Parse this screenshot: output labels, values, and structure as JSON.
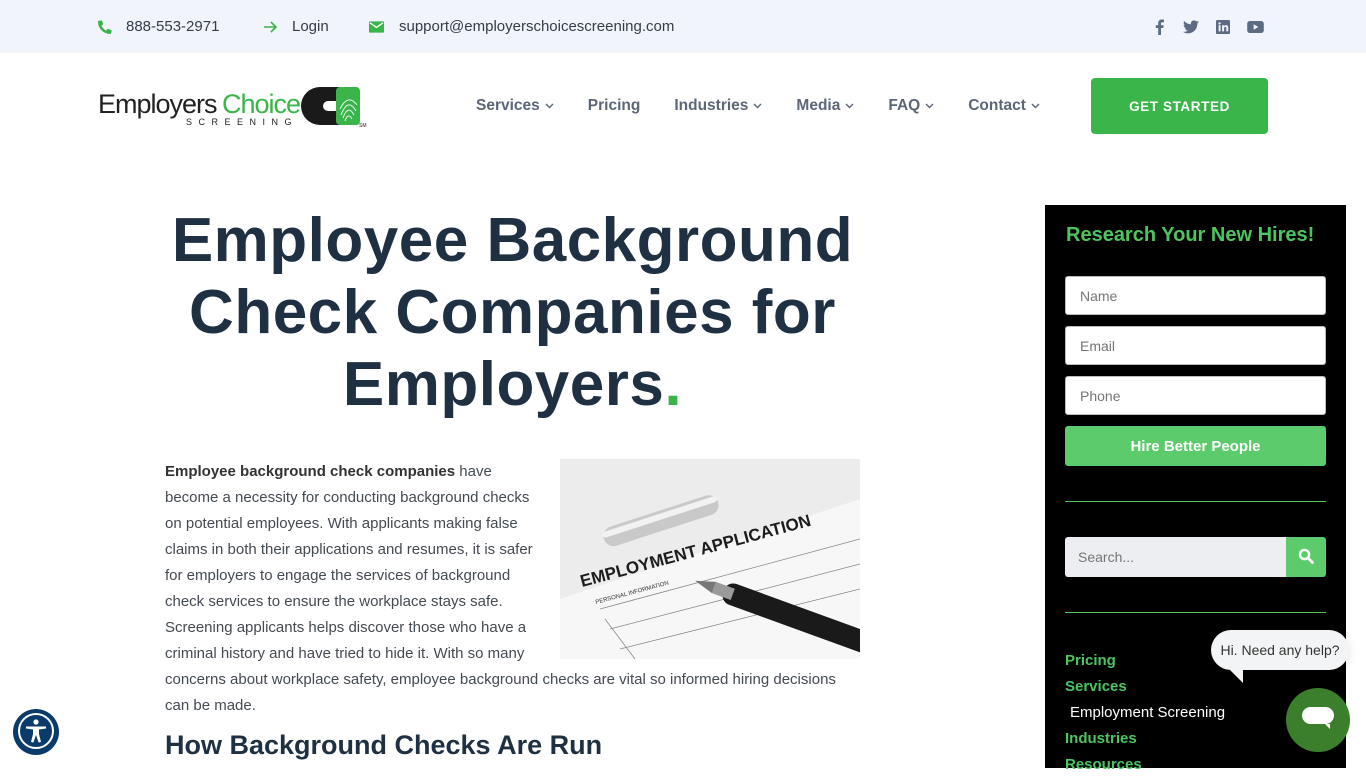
{
  "topbar": {
    "phone": "888-553-2971",
    "login": "Login",
    "email": "support@employerschoicescreening.com",
    "social": [
      "facebook-icon",
      "twitter-icon",
      "linkedin-icon",
      "youtube-icon"
    ]
  },
  "header": {
    "logo": {
      "word1": "Employers",
      "word2": "Choice",
      "tagline": "SCREENING",
      "mark": "SM"
    },
    "nav": [
      {
        "label": "Services",
        "dropdown": true
      },
      {
        "label": "Pricing",
        "dropdown": false
      },
      {
        "label": "Industries",
        "dropdown": true
      },
      {
        "label": "Media",
        "dropdown": true
      },
      {
        "label": "FAQ",
        "dropdown": true
      },
      {
        "label": "Contact",
        "dropdown": true
      }
    ],
    "cta": "GET STARTED"
  },
  "colors": {
    "brand_green": "#3ab54a",
    "heading": "#1f3042",
    "sidebar_green": "#4cc460",
    "chat_green": "#3b7f2d",
    "a11y_blue": "#0b3b6b"
  },
  "main": {
    "title": "Employee Background Check Companies for Employers",
    "title_dot": ".",
    "intro_bold": "Employee background check companies",
    "intro_rest": " have become a necessity for conducting background checks on potential employees. With applicants making false claims in both their applications and resumes, it is safer for employers to engage the services of background check services to ensure the workplace stays safe. Screening applicants helps discover those who have a criminal history and have tried to hide it. With so many concerns about workplace safety, employee background checks are vital so informed hiring decisions can be made.",
    "image_alt": "Employment application form with pen",
    "image_text": {
      "title": "EMPLOYMENT APPLICATION",
      "sub": "PERSONAL INFORMATION"
    },
    "h2": "How Background Checks Are Run"
  },
  "sidebar": {
    "title": "Research Your New Hires!",
    "name_placeholder": "Name",
    "email_placeholder": "Email",
    "phone_placeholder": "Phone",
    "submit": "Hire Better People",
    "search_placeholder": "Search...",
    "links": [
      {
        "label": "Pricing",
        "sub": false
      },
      {
        "label": "Services",
        "sub": false
      },
      {
        "label": "Employment Screening",
        "sub": true
      },
      {
        "label": "Industries",
        "sub": false
      },
      {
        "label": "Resources",
        "sub": false
      }
    ]
  },
  "chat": {
    "greeting": "Hi. Need any help?"
  }
}
